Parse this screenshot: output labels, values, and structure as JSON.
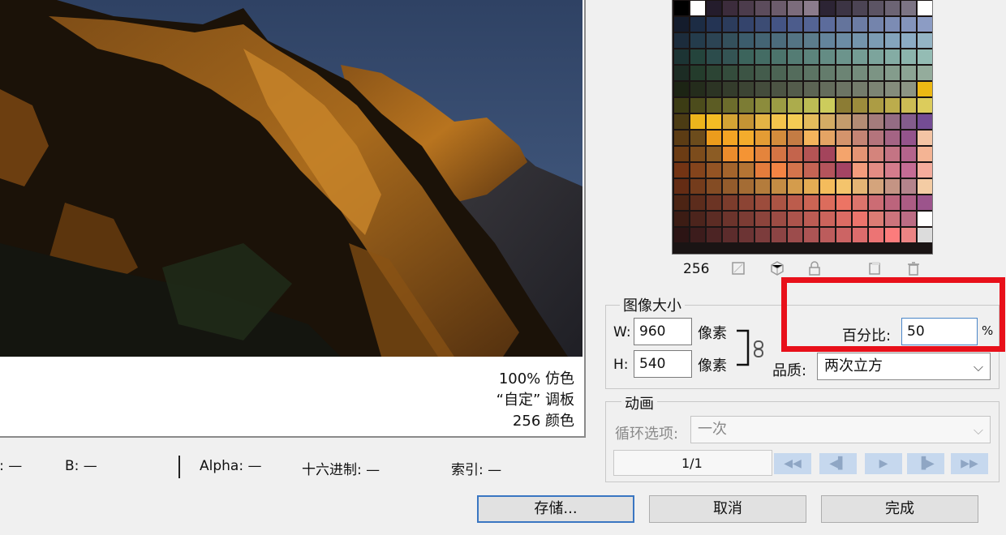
{
  "preview": {
    "dither_line": "100% 仿色",
    "palette_line": "“自定” 调板",
    "colors_line": "256 颜色"
  },
  "status_bar": {
    "g": "G: —",
    "b": "B: —",
    "alpha": "Alpha: —",
    "hex": "十六进制: —",
    "index": "索引: —"
  },
  "color_table": {
    "count": "256",
    "icons": [
      "map-icon",
      "web-cube-icon",
      "lock-icon",
      "new-swatch-icon",
      "trash-icon"
    ],
    "colors": [
      "#000000",
      "#ffffff",
      "#241c2c",
      "#3c2c3c",
      "#4c3c4c",
      "#5c4c5c",
      "#6c5c6c",
      "#7c6c7c",
      "#8c7c8c",
      "#2c2434",
      "#3c3444",
      "#4c4454",
      "#5c5464",
      "#6c6474",
      "#7c7484",
      "#ffffff",
      "#141c2c",
      "#1c2c44",
      "#243454",
      "#2c3c5c",
      "#34446c",
      "#3c4c74",
      "#445484",
      "#4c5c8c",
      "#546494",
      "#5c6c9c",
      "#64749c",
      "#6c7ca4",
      "#7484ac",
      "#7c8cb4",
      "#8494bc",
      "#8c9cc4",
      "#1c2c3c",
      "#243c4c",
      "#2c4454",
      "#34505c",
      "#3c5c6c",
      "#446474",
      "#4c6c7c",
      "#547484",
      "#5c7c8c",
      "#64849c",
      "#6c8ca4",
      "#7494ac",
      "#7c9cb4",
      "#84a4bc",
      "#8cacc4",
      "#94b4c4",
      "#1c3434",
      "#24443c",
      "#2c4c4c",
      "#345454",
      "#3c645c",
      "#446c64",
      "#4c746c",
      "#547c74",
      "#5c847c",
      "#648c84",
      "#6c948c",
      "#749c94",
      "#7ca49c",
      "#84aca4",
      "#8cb4ac",
      "#94bcb4",
      "#1c2c24",
      "#243c2c",
      "#2c4434",
      "#344c3c",
      "#3c5444",
      "#445c4c",
      "#4c6454",
      "#546c5c",
      "#5c7464",
      "#647c6c",
      "#6c8474",
      "#748c7c",
      "#7c9484",
      "#849c8c",
      "#8ca494",
      "#94ac9c",
      "#1c2414",
      "#242c1c",
      "#2c3424",
      "#343c2c",
      "#3c4434",
      "#444c3c",
      "#4c5444",
      "#545c4c",
      "#5c6454",
      "#646c5c",
      "#6c7464",
      "#747c6c",
      "#7c8474",
      "#848c7c",
      "#8c9484",
      "#ecb814",
      "#3c3c14",
      "#4c4c1c",
      "#5c5c24",
      "#6c6c2c",
      "#7c7c34",
      "#8c8c3c",
      "#9c9c44",
      "#acac4c",
      "#bcbc54",
      "#cccc5c",
      "#8c7c34",
      "#9c8c3c",
      "#ac9c44",
      "#bcac4c",
      "#ccbc54",
      "#dccc5c",
      "#4c3c14",
      "#ecb41c",
      "#f4bc24",
      "#d4a434",
      "#c49434",
      "#e4b444",
      "#f4c44c",
      "#f4cc54",
      "#e4bc5c",
      "#d4ac64",
      "#c49c6c",
      "#b48c74",
      "#a47c7c",
      "#946c84",
      "#845c8c",
      "#744c94",
      "#5c3c14",
      "#6c4c1c",
      "#ec9c1c",
      "#f4a424",
      "#f4ac2c",
      "#e49c34",
      "#d48c3c",
      "#c47c44",
      "#f4b45c",
      "#e4a464",
      "#d4946c",
      "#c48474",
      "#b4747c",
      "#a46484",
      "#94548c",
      "#f4c4a4",
      "#6c3c14",
      "#7c4c1c",
      "#8c5c24",
      "#ec8c2c",
      "#f49434",
      "#e4843c",
      "#d47444",
      "#c4644c",
      "#b45454",
      "#a4445c",
      "#f4a46c",
      "#e49474",
      "#d4847c",
      "#c47484",
      "#b4648c",
      "#f4b494",
      "#743414",
      "#84441c",
      "#945424",
      "#a4642c",
      "#b47434",
      "#e47c3c",
      "#f48444",
      "#d4744c",
      "#c46454",
      "#b4545c",
      "#a44464",
      "#f49c7c",
      "#e48c84",
      "#d47c8c",
      "#c46c94",
      "#f4ac9c",
      "#642c14",
      "#743c1c",
      "#844c24",
      "#945c2c",
      "#a46c34",
      "#b47c3c",
      "#c48c44",
      "#d49c4c",
      "#e4ac54",
      "#f4bc5c",
      "#f4c46c",
      "#e4b474",
      "#d4a47c",
      "#c49484",
      "#b4848c",
      "#f4cca4",
      "#4c2414",
      "#5c2c1c",
      "#6c3424",
      "#7c3c2c",
      "#8c4434",
      "#9c4c3c",
      "#ac5444",
      "#bc5c4c",
      "#cc6454",
      "#dc6c5c",
      "#ec7464",
      "#dc746c",
      "#cc6c74",
      "#bc647c",
      "#ac5c84",
      "#9c548c",
      "#3c1c14",
      "#4c241c",
      "#5c2c24",
      "#6c342c",
      "#7c3c34",
      "#8c443c",
      "#9c4c44",
      "#ac544c",
      "#bc5c54",
      "#cc645c",
      "#dc6c64",
      "#ec746c",
      "#dc7c74",
      "#cc747c",
      "#bc6c84",
      "#ffffff",
      "#2c1414",
      "#3c1c1c",
      "#4c2424",
      "#5c2c2c",
      "#6c3434",
      "#7c3c3c",
      "#8c4444",
      "#9c4c4c",
      "#ac5454",
      "#bc5c5c",
      "#cc6464",
      "#dc6c6c",
      "#ec7474",
      "#fc7c7c",
      "#ec8484",
      "#dcdcdc"
    ]
  },
  "image_size": {
    "title": "图像大小",
    "width_label": "W:",
    "width_value": "960",
    "height_label": "H:",
    "height_value": "540",
    "unit": "像素",
    "percent_label": "百分比:",
    "percent_value": "50",
    "percent_unit": "%",
    "quality_label": "品质:",
    "quality_value": "两次立方"
  },
  "animation": {
    "title": "动画",
    "loop_label": "循环选项:",
    "loop_value": "一次",
    "frame_counter": "1/1",
    "nav_icons": [
      "first-frame-icon",
      "previous-frame-icon",
      "play-icon",
      "next-frame-icon",
      "last-frame-icon"
    ]
  },
  "buttons": {
    "save": "存储...",
    "cancel": "取消",
    "done": "完成"
  },
  "colors": {
    "highlight": "#e8101a",
    "primary_border": "#3a76c2"
  }
}
